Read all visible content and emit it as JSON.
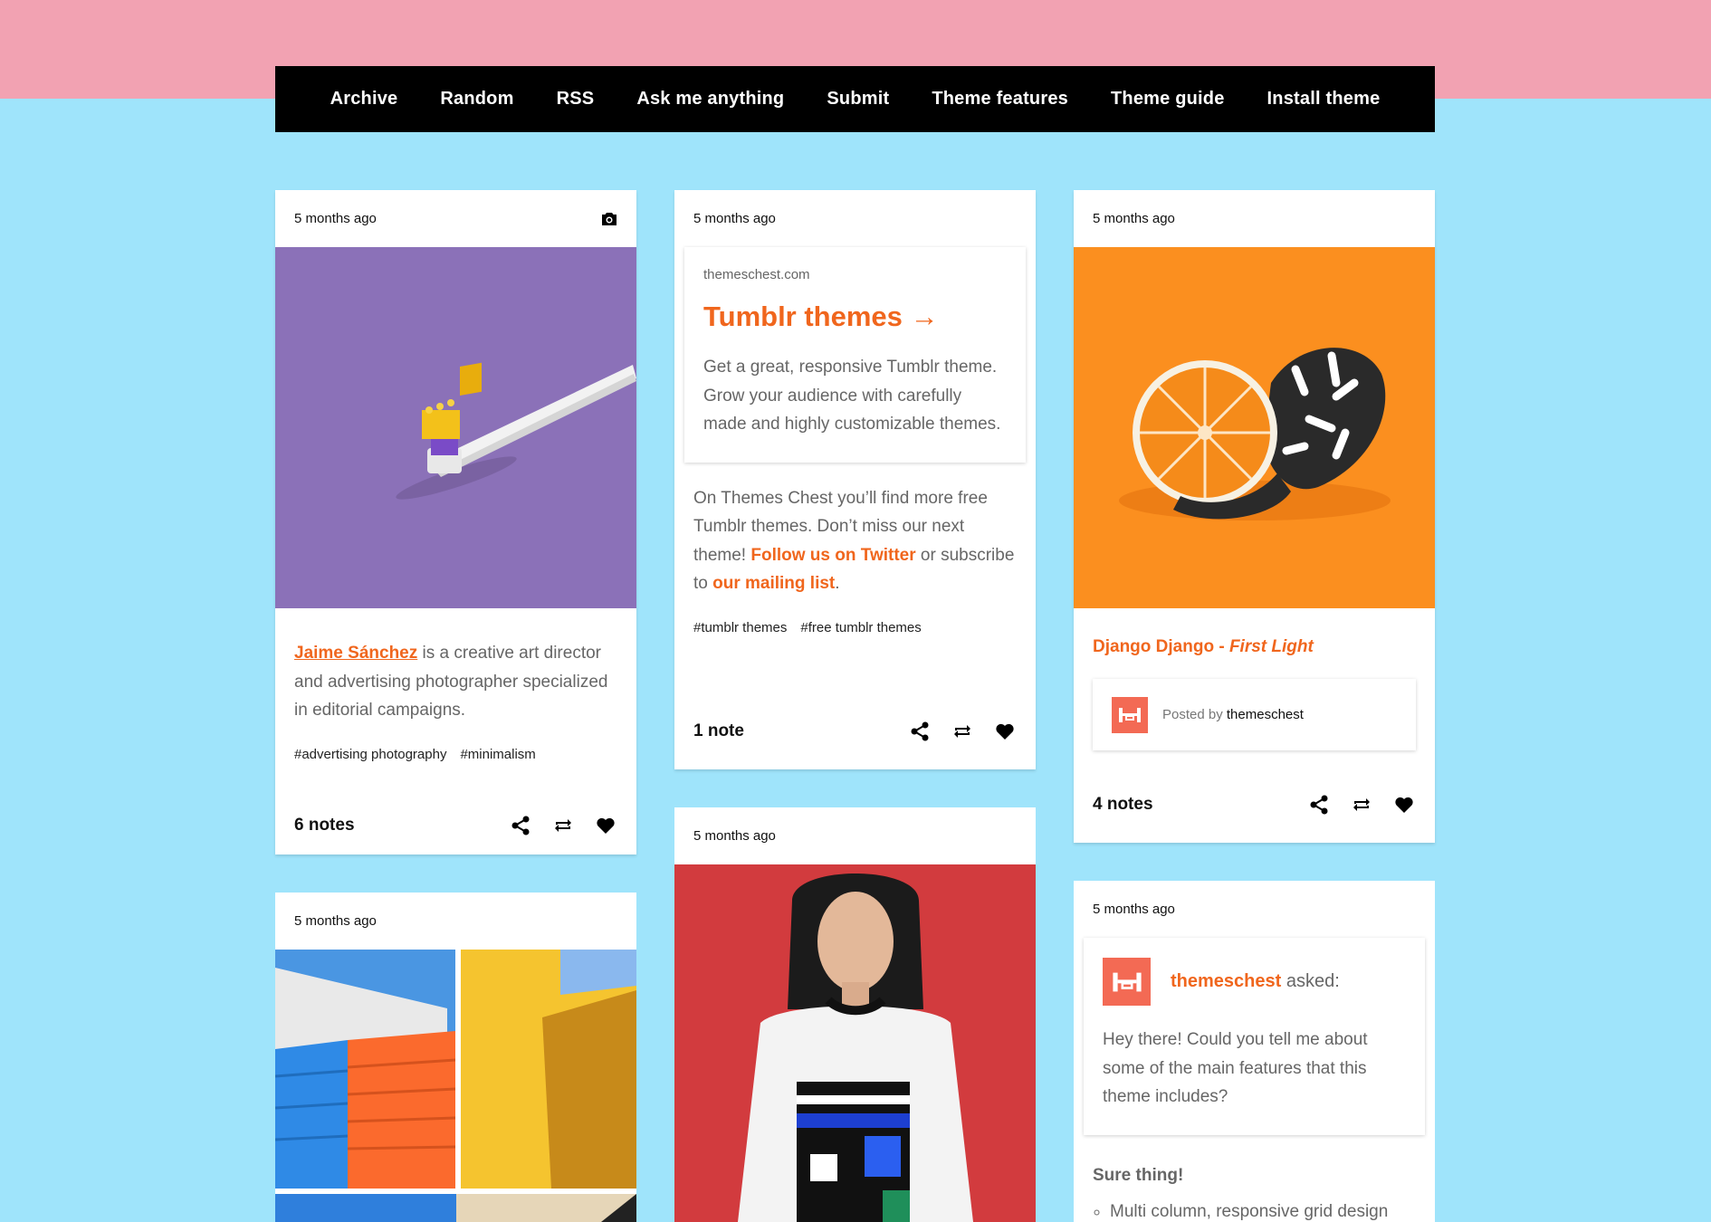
{
  "nav": [
    "Archive",
    "Random",
    "RSS",
    "Ask me anything",
    "Submit",
    "Theme features",
    "Theme guide",
    "Install theme"
  ],
  "posts": {
    "photo1": {
      "time": "5 months ago",
      "author": "Jaime Sánchez",
      "caption_rest": " is a creative art director and advertising photographer specialized in editorial campaigns.",
      "tags": [
        "#advertising photography",
        "#minimalism"
      ],
      "notes": "6 notes"
    },
    "link": {
      "time": "5 months ago",
      "host": "themeschest.com",
      "title": "Tumblr themes →",
      "desc": "Get a great, responsive Tumblr theme. Grow your audience with carefully made and highly customizable themes.",
      "body_1": "On Themes Chest you’ll find more free Tumblr themes. Don’t miss our next theme! ",
      "body_link_1": "Follow us on Twitter",
      "body_2": " or subscribe to ",
      "body_link_2": "our mailing list",
      "body_3": ".",
      "tags": [
        "#tumblr themes",
        "#free tumblr themes"
      ],
      "notes": "1 note"
    },
    "audio": {
      "time": "5 months ago",
      "title_artist": "Django Django - ",
      "title_track": "First Light",
      "posted_prefix": "Posted by ",
      "posted_user": "themeschest",
      "notes": "4 notes"
    },
    "photoset": {
      "time": "5 months ago"
    },
    "photo2": {
      "time": "5 months ago"
    },
    "ask": {
      "time": "5 months ago",
      "asker": "themeschest",
      "asked": " asked:",
      "question": "Hey there! Could you tell me about some of the main features that this theme includes?",
      "answer_title": "Sure thing!",
      "answer_item": "Multi column, responsive grid design"
    }
  },
  "colors": {
    "accent": "#f0661d",
    "background": "#9fe4fb",
    "top_band": "#f2a2b2",
    "nav": "#000000"
  }
}
